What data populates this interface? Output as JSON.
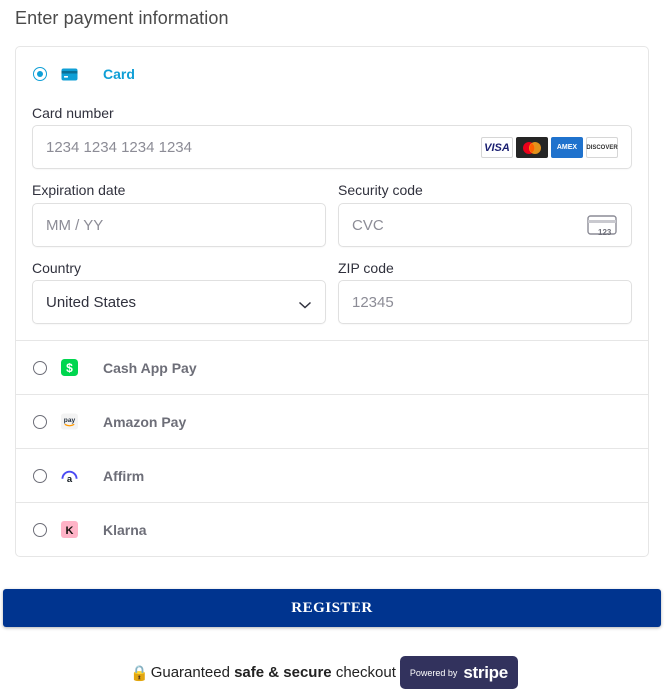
{
  "page": {
    "heading": "Enter payment information"
  },
  "card": {
    "label": "Card",
    "card_number": {
      "label": "Card number",
      "placeholder": "1234 1234 1234 1234"
    },
    "brands": [
      "VISA",
      "Mastercard",
      "AMEX",
      "DISCOVER"
    ],
    "expiration": {
      "label": "Expiration date",
      "placeholder": "MM / YY"
    },
    "security": {
      "label": "Security code",
      "placeholder": "CVC",
      "icon_text": "123"
    },
    "country": {
      "label": "Country",
      "value": "United States"
    },
    "zip": {
      "label": "ZIP code",
      "placeholder": "12345"
    }
  },
  "methods": [
    {
      "label": "Cash App Pay",
      "icon": "cash-app-icon"
    },
    {
      "label": "Amazon Pay",
      "icon": "amazon-pay-icon"
    },
    {
      "label": "Affirm",
      "icon": "affirm-icon"
    },
    {
      "label": "Klarna",
      "icon": "klarna-icon"
    }
  ],
  "register": {
    "label": "REGISTER"
  },
  "footer": {
    "prefix": "Guaranteed",
    "bold": "safe & secure",
    "suffix": "checkout",
    "badge_small": "Powered by",
    "badge_big": "stripe"
  },
  "colors": {
    "accent": "#0f9fd6",
    "button": "#00348f",
    "badge": "#32325d"
  }
}
